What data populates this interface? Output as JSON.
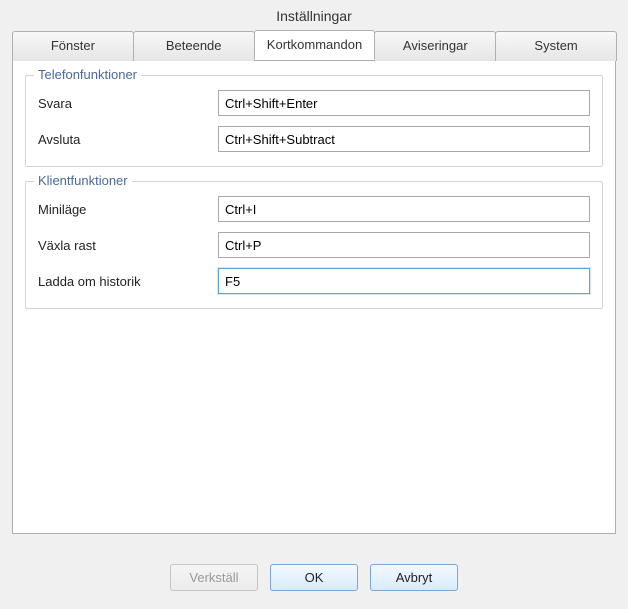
{
  "title": "Inställningar",
  "tabs": [
    {
      "label": "Fönster",
      "active": false
    },
    {
      "label": "Beteende",
      "active": false
    },
    {
      "label": "Kortkommandon",
      "active": true
    },
    {
      "label": "Aviseringar",
      "active": false
    },
    {
      "label": "System",
      "active": false
    }
  ],
  "groups": {
    "telephony": {
      "legend": "Telefonfunktioner",
      "answer": {
        "label": "Svara",
        "value": "Ctrl+Shift+Enter"
      },
      "end": {
        "label": "Avsluta",
        "value": "Ctrl+Shift+Subtract"
      }
    },
    "client": {
      "legend": "Klientfunktioner",
      "miniMode": {
        "label": "Miniläge",
        "value": "Ctrl+I"
      },
      "toggleRest": {
        "label": "Växla rast",
        "value": "Ctrl+P"
      },
      "reloadHist": {
        "label": "Ladda om historik",
        "value": "F5",
        "focused": true
      }
    }
  },
  "buttons": {
    "apply": "Verkställ",
    "ok": "OK",
    "cancel": "Avbryt"
  }
}
